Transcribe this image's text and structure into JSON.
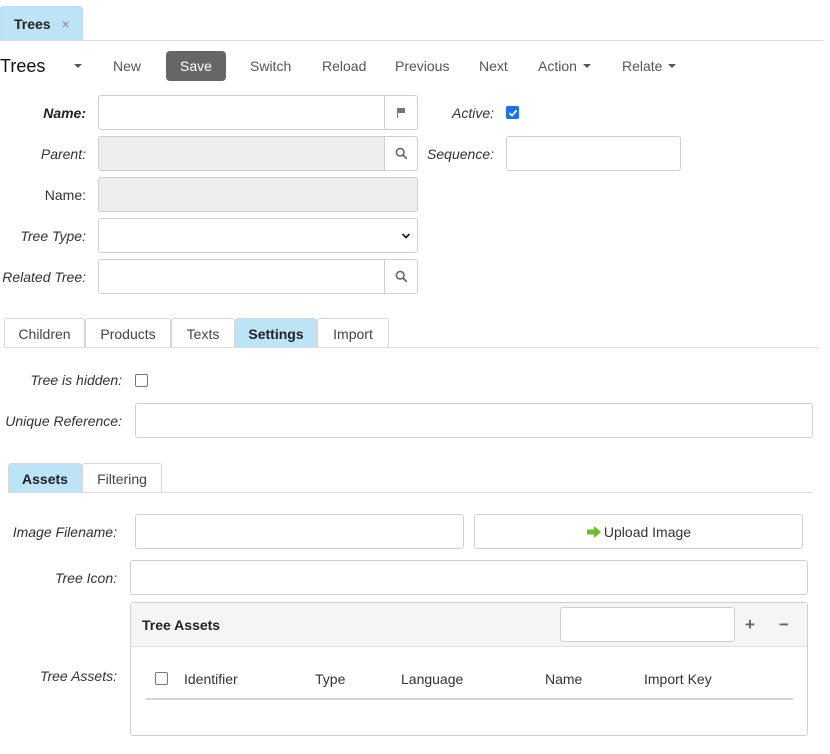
{
  "tab": {
    "label": "Trees",
    "close": "×"
  },
  "toolbar": {
    "title": "Trees",
    "new": "New",
    "save": "Save",
    "switch": "Switch",
    "reload": "Reload",
    "previous": "Previous",
    "next": "Next",
    "action": "Action",
    "relate": "Relate"
  },
  "form": {
    "name_label": "Name:",
    "active_label": "Active:",
    "active_checked": true,
    "parent_label": "Parent:",
    "sequence_label": "Sequence:",
    "name2_label": "Name:",
    "tree_type_label": "Tree Type:",
    "related_tree_label": "Related Tree:"
  },
  "tabs": [
    "Children",
    "Products",
    "Texts",
    "Settings",
    "Import"
  ],
  "settings": {
    "hidden_label": "Tree is hidden:",
    "unique_ref_label": "Unique Reference:"
  },
  "subtabs": [
    "Assets",
    "Filtering"
  ],
  "assets": {
    "image_filename_label": "Image Filename:",
    "upload_button": "Upload Image",
    "tree_icon_label": "Tree Icon:",
    "tree_assets_label": "Tree Assets:",
    "panel_title": "Tree Assets",
    "add": "+",
    "remove": "−",
    "columns": [
      "Identifier",
      "Type",
      "Language",
      "Name",
      "Import Key"
    ]
  },
  "colors": {
    "tab_active": "#bde3f7",
    "save_bg": "#666666",
    "check": "#1a73e8",
    "upload_arrow": "#6bbf2a"
  }
}
